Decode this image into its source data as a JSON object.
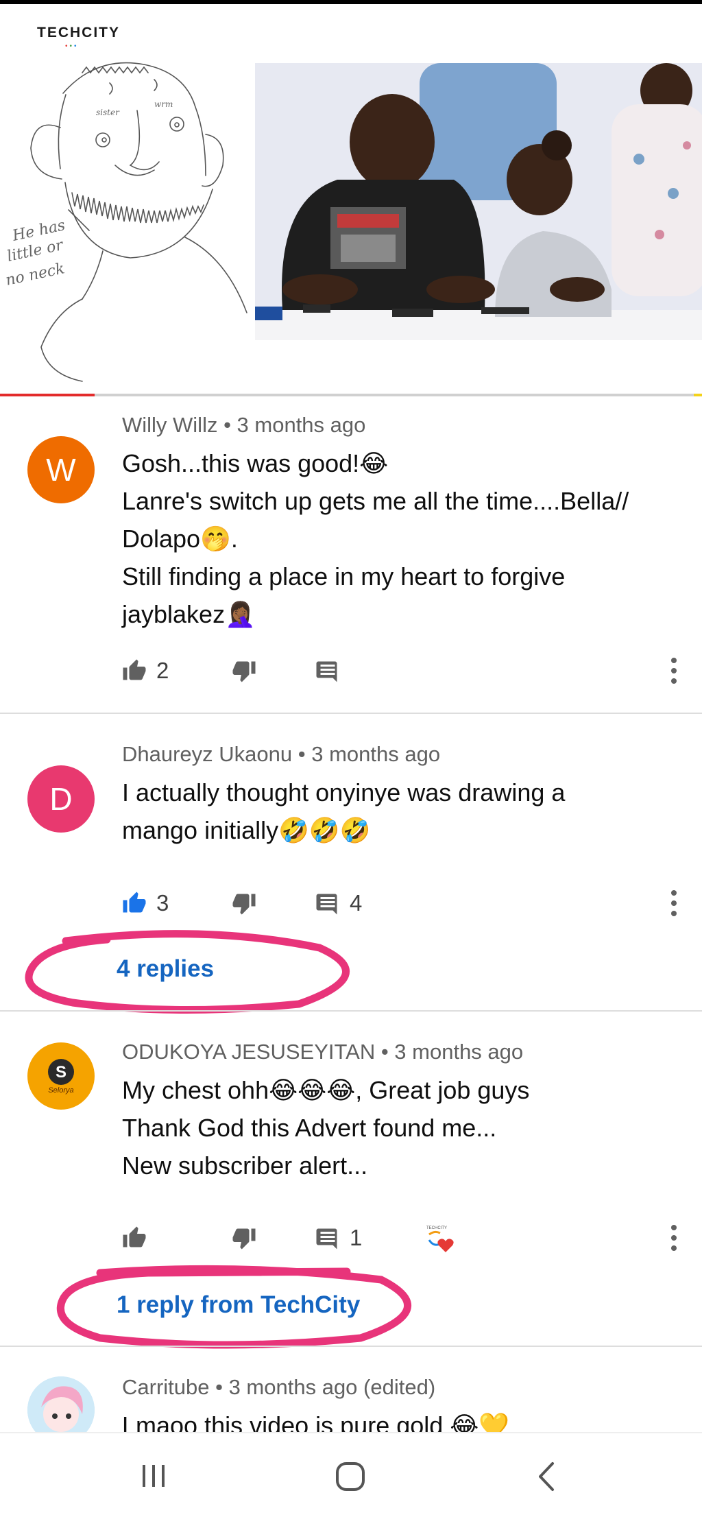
{
  "video": {
    "brand": "TECHCITY",
    "sketch_note": "He has little or no neck",
    "sketch_small_1": "sister",
    "sketch_small_2": "wrm",
    "progress": 0.135
  },
  "comments": [
    {
      "avatar_letter": "W",
      "avatar_color": "#ef6c00",
      "meta": "Willy Willz • 3 months ago",
      "lines": [
        "Gosh...this was good!😂",
        "Lanre's switch up gets me all the time....Bella//",
        "Dolapo🤭.",
        "Still finding a place in my heart to forgive",
        "jayblakez🤦🏾‍♀️"
      ],
      "likes": "2",
      "liked": false
    },
    {
      "avatar_letter": "D",
      "avatar_color": "#e8396f",
      "meta": "Dhaureyz Ukaonu • 3 months ago",
      "lines": [
        "I actually thought onyinye was drawing a",
        "mango initially🤣🤣🤣"
      ],
      "likes": "3",
      "liked": true,
      "replies_count": "4",
      "replies_label": "4 replies"
    },
    {
      "avatar_letter": "S",
      "avatar_color": "#f5a300",
      "avatar_caption": "Selorya",
      "meta": "ODUKOYA JESUSEYITAN • 3 months ago",
      "lines": [
        "My chest ohh😂😂😂, Great job guys",
        "Thank God this Advert found me...",
        "New subscriber alert..."
      ],
      "likes": "",
      "liked": false,
      "replies_count": "1",
      "creator_heart_label": "TECHCITY",
      "replies_label": "1 reply from TechCity"
    },
    {
      "meta": "Carritube • 3 months ago (edited)",
      "lines": [
        "Lmaoo this video is pure gold 😂💛"
      ]
    }
  ],
  "colors": {
    "link_blue": "#1565c0",
    "marker_pink": "#e8347a",
    "like_blue": "#1a73e8"
  }
}
